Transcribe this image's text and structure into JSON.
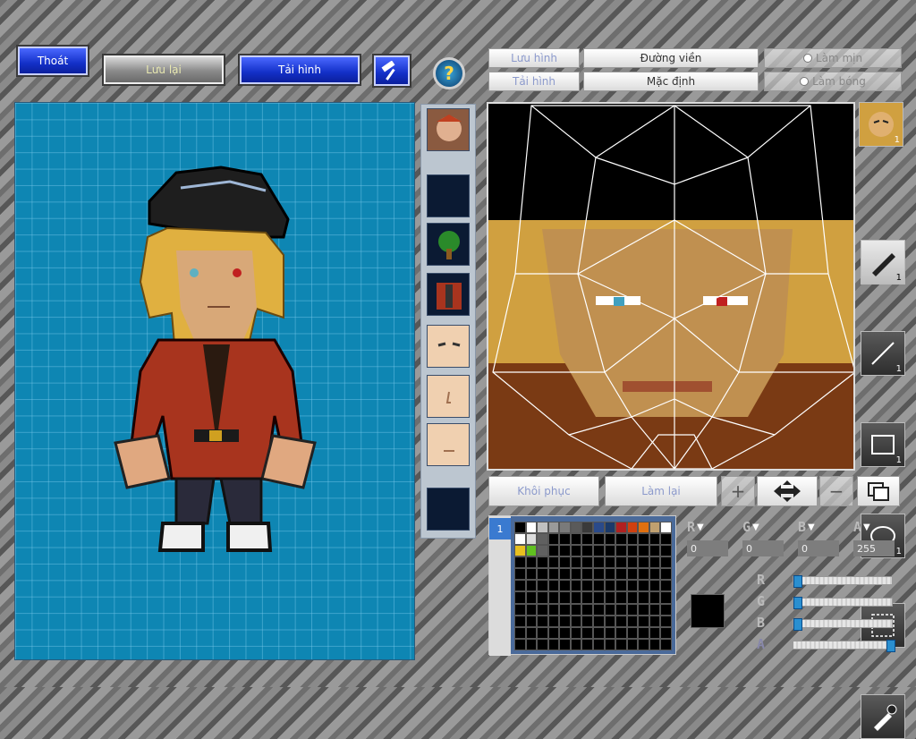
{
  "top_left_buttons": {
    "exit": "Thoát",
    "save": "Lưu lại",
    "reload": "Tải hình"
  },
  "right_header": {
    "save_image": "Lưu hình",
    "load_image": "Tải hình",
    "outline": "Đường viền",
    "default": "Mặc định",
    "smooth": "Làm mịn",
    "shade": "Làm bóng"
  },
  "tool_counts": {
    "portrait": "1",
    "pen": "1",
    "line": "1",
    "rect": "1",
    "ellipse": "1"
  },
  "bottom_buttons": {
    "restore": "Khôi phục",
    "redo": "Làm lại"
  },
  "palette_tab": "1",
  "channels": {
    "r_value": "0",
    "g_value": "0",
    "b_value": "0",
    "a_value": "255",
    "r_level": 0.0,
    "g_level": 0.0,
    "b_level": 0.0,
    "a_level": 1.0
  },
  "palette_colors": [
    "#000000",
    "#ffffff",
    "#c0c0c0",
    "#9a9a9a",
    "#7a7a7a",
    "#5a5a5a",
    "#3a3a3a",
    "#2a4a8a",
    "#1a3a6a",
    "#b02020",
    "#d04010",
    "#e07010",
    "#c0a070",
    "#ffffff",
    "#ffffff",
    "#dcdcdc",
    "#606060",
    "#000000",
    "#000000",
    "#000000",
    "#000000",
    "#000000",
    "#000000",
    "#000000",
    "#000000",
    "#000000",
    "#000000",
    "#000000",
    "#e8c020",
    "#60c020",
    "#606060"
  ],
  "colors": {
    "accent_blue": "#1330c8",
    "canvas_bg": "#0e86b3",
    "selected_color": "#000000"
  }
}
